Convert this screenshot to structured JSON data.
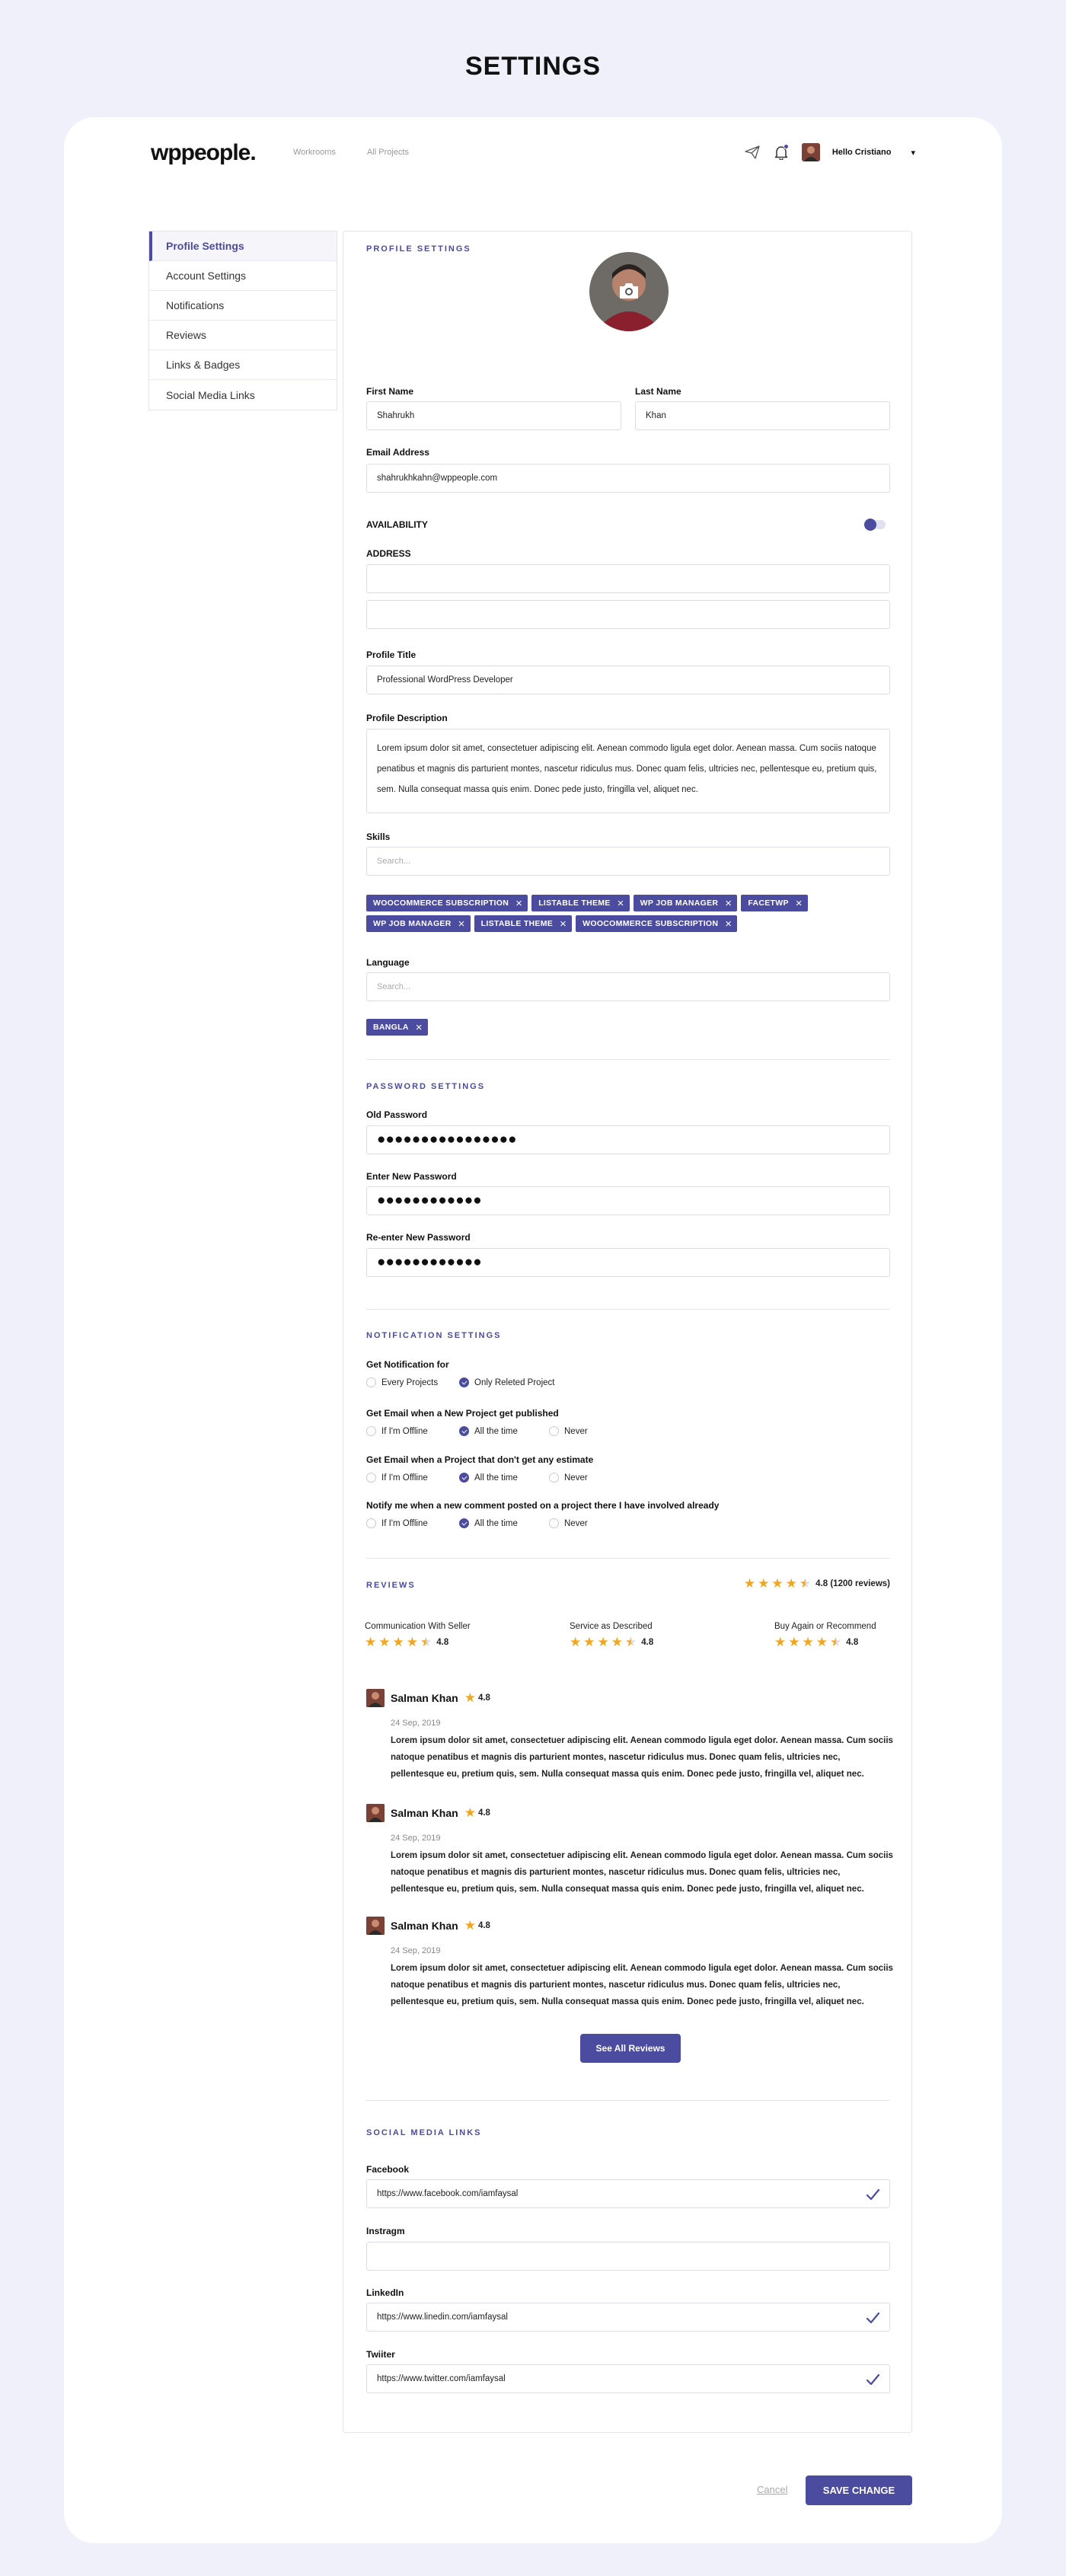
{
  "page_title": "SETTINGS",
  "nav": {
    "logo": "wppeople.",
    "links": [
      "Workrooms",
      "All Projects"
    ],
    "greeting": "Hello Cristiano",
    "caret": "▾"
  },
  "sidebar": {
    "items": [
      {
        "label": "Profile Settings",
        "active": true
      },
      {
        "label": "Account Settings"
      },
      {
        "label": "Notifications"
      },
      {
        "label": "Reviews"
      },
      {
        "label": "Links & Badges"
      },
      {
        "label": "Social Media Links"
      }
    ]
  },
  "profile": {
    "section_title": "PROFILE SETTINGS",
    "first_name_label": "First Name",
    "first_name": "Shahrukh",
    "last_name_label": "Last Name",
    "last_name": "Khan",
    "email_label": "Email Address",
    "email": "shahrukhkahn@wppeople.com",
    "availability_label": "AVAILABILITY",
    "address_label": "ADDRESS",
    "address_line1": "",
    "address_line2": "",
    "title_label": "Profile Title",
    "title": "Professional WordPress Developer",
    "description_label": "Profile Description",
    "description": "Lorem ipsum dolor sit amet, consectetuer adipiscing elit. Aenean commodo ligula eget dolor. Aenean massa. Cum sociis natoque penatibus et magnis dis parturient montes, nascetur ridiculus mus. Donec quam felis, ultricies nec, pellentesque eu, pretium quis, sem. Nulla consequat massa quis enim. Donec pede justo, fringilla vel, aliquet nec.",
    "skills_label": "Skills",
    "skills_placeholder": "Search...",
    "skills_row1": [
      "WOOCOMMERCE SUBSCRIPTION",
      "LISTABLE THEME",
      "WP JOB MANAGER",
      "FACETWP"
    ],
    "skills_row2": [
      "WP JOB MANAGER",
      "LISTABLE THEME",
      "WOOCOMMERCE SUBSCRIPTION"
    ],
    "language_label": "Language",
    "language_placeholder": "Search...",
    "languages": [
      "BANGLA"
    ]
  },
  "password": {
    "section_title": "PASSWORD SETTINGS",
    "old_label": "Old Password",
    "old_value": "●●●●●●●●●●●●●●●●",
    "new_label": "Enter New Password",
    "new_value": "●●●●●●●●●●●●",
    "reenter_label": "Re-enter New Password",
    "reenter_value": "●●●●●●●●●●●●"
  },
  "notifications": {
    "section_title": "NOTIFICATION SETTINGS",
    "groups": [
      {
        "question": "Get Notification for",
        "options": [
          "Every Projects",
          "Only Releted Project"
        ],
        "selected": 1
      },
      {
        "question": "Get Email when a New Project get published",
        "options": [
          "If I'm Offline",
          "All the time",
          "Never"
        ],
        "selected": 1
      },
      {
        "question": "Get Email when a Project that don't get any estimate",
        "options": [
          "If I'm Offline",
          "All the time",
          "Never"
        ],
        "selected": 1
      },
      {
        "question": "Notify me when a new comment posted on a project there I have involved already",
        "options": [
          "If I'm Offline",
          "All the time",
          "Never"
        ],
        "selected": 1
      }
    ]
  },
  "reviews": {
    "section_title": "REVIEWS",
    "overall": "4.8 (1200 reviews)",
    "overall_stars": 4.5,
    "categories": [
      {
        "label": "Communication With Seller",
        "rating": "4.8",
        "stars": 4.5
      },
      {
        "label": "Service as Described",
        "rating": "4.8",
        "stars": 4.5
      },
      {
        "label": "Buy Again or Recommend",
        "rating": "4.8",
        "stars": 4.5
      }
    ],
    "items": [
      {
        "name": "Salman Khan",
        "rating": "4.8",
        "date": "24 Sep, 2019",
        "text": "Lorem ipsum dolor sit amet, consectetuer adipiscing elit. Aenean commodo ligula eget dolor. Aenean massa. Cum sociis natoque penatibus et magnis dis parturient montes, nascetur ridiculus mus. Donec quam felis, ultricies nec, pellentesque eu, pretium quis, sem. Nulla consequat massa quis enim. Donec pede justo, fringilla vel, aliquet nec."
      },
      {
        "name": "Salman Khan",
        "rating": "4.8",
        "date": "24 Sep, 2019",
        "text": "Lorem ipsum dolor sit amet, consectetuer adipiscing elit. Aenean commodo ligula eget dolor. Aenean massa. Cum sociis natoque penatibus et magnis dis parturient montes, nascetur ridiculus mus. Donec quam felis, ultricies nec, pellentesque eu, pretium quis, sem. Nulla consequat massa quis enim. Donec pede justo, fringilla vel, aliquet nec."
      },
      {
        "name": "Salman Khan",
        "rating": "4.8",
        "date": "24 Sep, 2019",
        "text": "Lorem ipsum dolor sit amet, consectetuer adipiscing elit. Aenean commodo ligula eget dolor. Aenean massa. Cum sociis natoque penatibus et magnis dis parturient montes, nascetur ridiculus mus. Donec quam felis, ultricies nec, pellentesque eu, pretium quis, sem. Nulla consequat massa quis enim. Donec pede justo, fringilla vel, aliquet nec."
      }
    ],
    "see_all": "See All Reviews"
  },
  "social": {
    "section_title": "SOCIAL MEDIA LINKS",
    "facebook_label": "Facebook",
    "facebook": "https://www.facebook.com/iamfaysal",
    "instagram_label": "Instragm",
    "instagram": "",
    "linkedin_label": "LinkedIn",
    "linkedin": "https://www.linedin.com/iamfaysal",
    "twitter_label": "Twiiter",
    "twitter": "https://www.twitter.com/iamfaysal"
  },
  "footer": {
    "cancel": "Cancel",
    "save": "SAVE CHANGE"
  },
  "colors": {
    "accent": "#4b4b9f",
    "background": "#f0f0fb",
    "star": "#f3a51d"
  }
}
